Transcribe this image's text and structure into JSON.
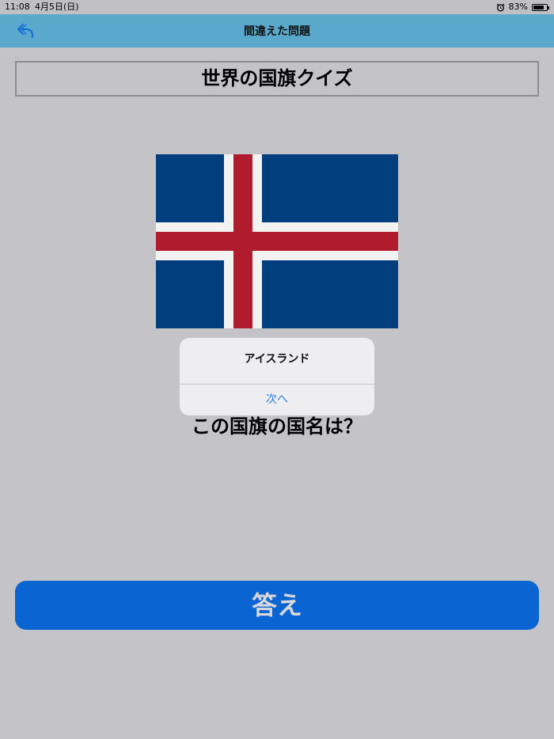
{
  "status_bar": {
    "time": "11:08",
    "date": "4月5日(日)",
    "alarm_icon": "alarm-clock-icon",
    "battery_text": "83%",
    "battery_level": 0.83
  },
  "nav": {
    "title": "間違えた問題",
    "back_icon": "back-arrow-icon",
    "accent_color": "#5aa9cd"
  },
  "quiz": {
    "title": "世界の国旗クイズ",
    "question": "この国旗の国名は？",
    "flag_colors": {
      "field": "#003e7e",
      "border": "#f2f2f2",
      "cross": "#b01b2e"
    }
  },
  "alert": {
    "title": "アイスランド",
    "button_label": "次へ"
  },
  "answer_button": {
    "label": "答え",
    "color": "#0a64d2"
  }
}
